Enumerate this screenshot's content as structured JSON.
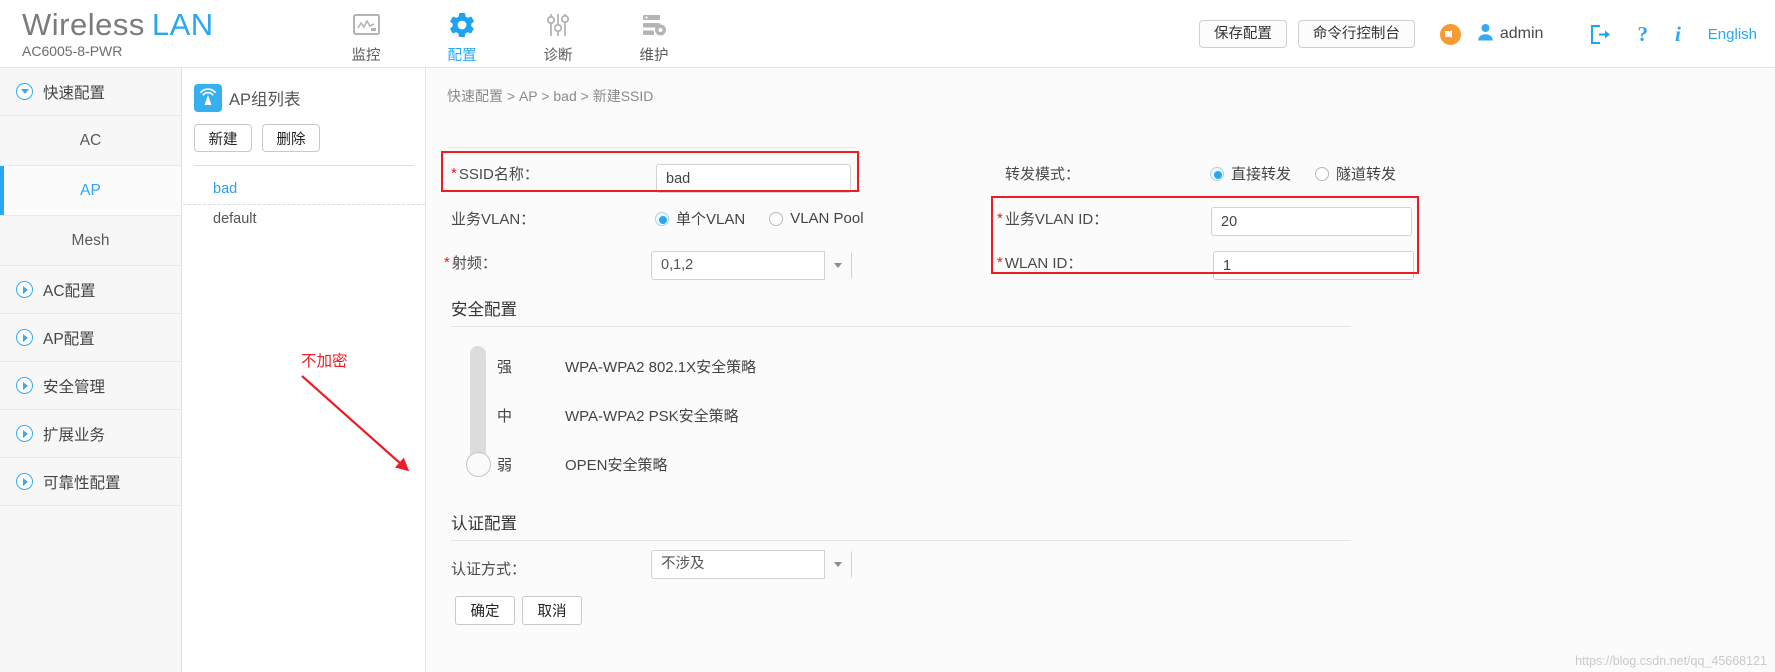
{
  "header": {
    "logo_primary": "Wireless",
    "logo_secondary": "LAN",
    "model": "AC6005-8-PWR",
    "nav": [
      {
        "label": "监控",
        "icon": "monitor-chart-icon",
        "active": false
      },
      {
        "label": "配置",
        "icon": "gear-icon",
        "active": true
      },
      {
        "label": "诊断",
        "icon": "sliders-icon",
        "active": false
      },
      {
        "label": "维护",
        "icon": "server-gear-icon",
        "active": false
      }
    ],
    "save_button": "保存配置",
    "console_button": "命令行控制台",
    "alarm_icon": "alarm-speaker-icon",
    "user_icon": "user-icon",
    "username": "admin",
    "logout_icon": "logout-icon",
    "help_label": "?",
    "info_label": "i",
    "language": "English"
  },
  "sidebar": {
    "items": [
      {
        "label": "快速配置",
        "expanded": true,
        "type": "group"
      },
      {
        "label": "AC",
        "type": "sub",
        "active": false
      },
      {
        "label": "AP",
        "type": "sub",
        "active": true
      },
      {
        "label": "Mesh",
        "type": "sub",
        "active": false
      },
      {
        "label": "AC配置",
        "expanded": false,
        "type": "group"
      },
      {
        "label": "AP配置",
        "expanded": false,
        "type": "group"
      },
      {
        "label": "安全管理",
        "expanded": false,
        "type": "group"
      },
      {
        "label": "扩展业务",
        "expanded": false,
        "type": "group"
      },
      {
        "label": "可靠性配置",
        "expanded": false,
        "type": "group"
      }
    ]
  },
  "ap_group_panel": {
    "icon": "wifi-signal-icon",
    "title": "AP组列表",
    "new_button": "新建",
    "delete_button": "删除",
    "groups": [
      {
        "name": "bad",
        "selected": true
      },
      {
        "name": "default",
        "selected": false
      }
    ]
  },
  "breadcrumb": {
    "parts": [
      "快速配置",
      "AP",
      "bad",
      "新建SSID"
    ],
    "separator": ">"
  },
  "form": {
    "ssid_name_label": "SSID名称：",
    "ssid_name_value": "bad",
    "service_vlan_label": "业务VLAN：",
    "vlan_single_label": "单个VLAN",
    "vlan_pool_label": "VLAN Pool",
    "vlan_mode_selected": "单个VLAN",
    "radio_label": "射频：",
    "radio_value": "0,1,2",
    "forward_mode_label": "转发模式：",
    "forward_direct_label": "直接转发",
    "forward_tunnel_label": "隧道转发",
    "forward_mode_selected": "直接转发",
    "service_vlan_id_label": "业务VLAN ID：",
    "service_vlan_id_value": "20",
    "wlan_id_label": "WLAN ID：",
    "wlan_id_value": "1"
  },
  "security": {
    "section_title": "安全配置",
    "levels": [
      {
        "level": "强",
        "policy": "WPA-WPA2 802.1X安全策略"
      },
      {
        "level": "中",
        "policy": "WPA-WPA2 PSK安全策略"
      },
      {
        "level": "弱",
        "policy": "OPEN安全策略"
      }
    ],
    "selected_level": "弱",
    "annotation": "不加密"
  },
  "auth": {
    "section_title": "认证配置",
    "method_label": "认证方式：",
    "method_value": "不涉及"
  },
  "footer": {
    "ok_button": "确定",
    "cancel_button": "取消",
    "watermark": "https://blog.csdn.net/qq_45668121"
  },
  "colors": {
    "accent": "#29a7f2",
    "annotation_red": "#ee1c25",
    "required_red": "#e02020",
    "alarm_orange": "#f79a33"
  }
}
